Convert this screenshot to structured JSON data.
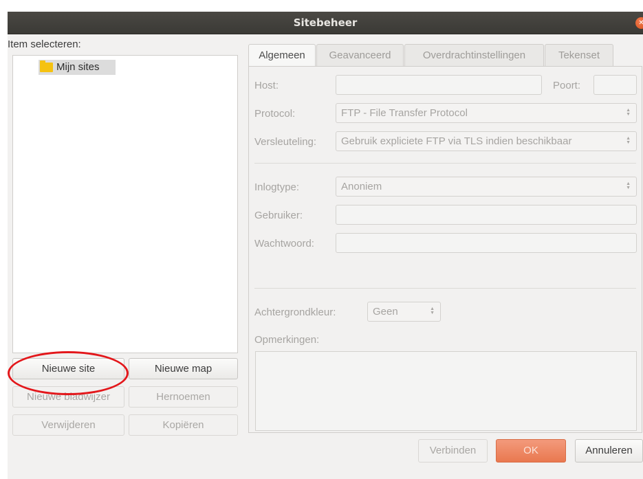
{
  "window": {
    "title": "Sitebeheer"
  },
  "left": {
    "select_label": "Item selecteren:",
    "tree": [
      {
        "label": "Mijn sites",
        "icon": "folder-icon"
      }
    ],
    "buttons": {
      "new_site": "Nieuwe site",
      "new_folder": "Nieuwe map",
      "new_bookmark": "Nieuwe bladwijzer",
      "rename": "Hernoemen",
      "delete": "Verwijderen",
      "copy": "Kopiëren"
    }
  },
  "tabs": [
    {
      "label": "Algemeen",
      "active": true
    },
    {
      "label": "Geavanceerd",
      "active": false
    },
    {
      "label": "Overdrachtinstellingen",
      "active": false
    },
    {
      "label": "Tekenset",
      "active": false
    }
  ],
  "general": {
    "host_label": "Host:",
    "host_value": "",
    "port_label": "Poort:",
    "port_value": "",
    "protocol_label": "Protocol:",
    "protocol_value": "FTP - File Transfer Protocol",
    "encryption_label": "Versleuteling:",
    "encryption_value": "Gebruik expliciete FTP via TLS indien beschikbaar",
    "logontype_label": "Inlogtype:",
    "logontype_value": "Anoniem",
    "user_label": "Gebruiker:",
    "user_value": "",
    "password_label": "Wachtwoord:",
    "password_value": "",
    "bgcolor_label": "Achtergrondkleur:",
    "bgcolor_value": "Geen",
    "comments_label": "Opmerkingen:",
    "comments_value": ""
  },
  "footer": {
    "connect": "Verbinden",
    "ok": "OK",
    "cancel": "Annuleren"
  },
  "colors": {
    "titlebar": "#3f3e3a",
    "ok_button": "#e9784f",
    "annotation": "#e3171b",
    "folder": "#f5c211"
  }
}
